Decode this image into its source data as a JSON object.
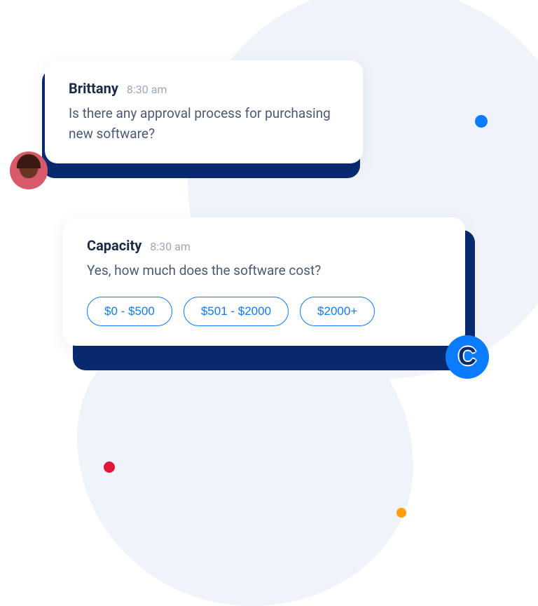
{
  "messages": [
    {
      "sender": "Brittany",
      "time": "8:30 am",
      "text": "Is there any approval process for purchasing new software?"
    },
    {
      "sender": "Capacity",
      "time": "8:30 am",
      "text": "Yes, how much does the software cost?",
      "options": [
        "$0 - $500",
        "$501 - $2000",
        "$2000+"
      ]
    }
  ],
  "bot_letter": "C"
}
